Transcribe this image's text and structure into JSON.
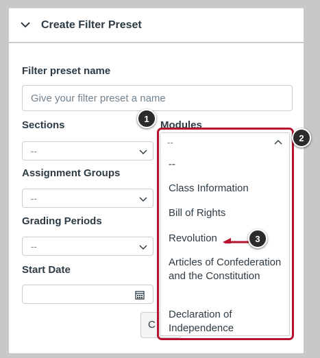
{
  "panel": {
    "title": "Create Filter Preset"
  },
  "form": {
    "preset_name_label": "Filter preset name",
    "preset_name_placeholder": "Give your filter preset a name",
    "sections_label": "Sections",
    "sections_value": "--",
    "modules_label": "Modules",
    "modules_value": "--",
    "assignment_groups_label": "Assignment Groups",
    "assignment_groups_value": "--",
    "grading_periods_label": "Grading Periods",
    "grading_periods_value": "--",
    "start_date_label": "Start Date",
    "partial_button_label": "C"
  },
  "modules_dropdown": {
    "options": [
      "--",
      "Class Information",
      "Bill of Rights",
      "Revolution",
      "Articles of Confederation and the Constitution",
      "Declaration of Independence"
    ]
  },
  "callouts": [
    "1",
    "2",
    "3"
  ],
  "colors": {
    "highlight": "#b5122e",
    "callout_bg": "#2b2b2b",
    "text": "#2d3b45",
    "placeholder": "#73818c"
  },
  "icons": [
    "chevron-down-icon",
    "chevron-up-icon",
    "calendar-icon",
    "arrow-left-icon"
  ]
}
